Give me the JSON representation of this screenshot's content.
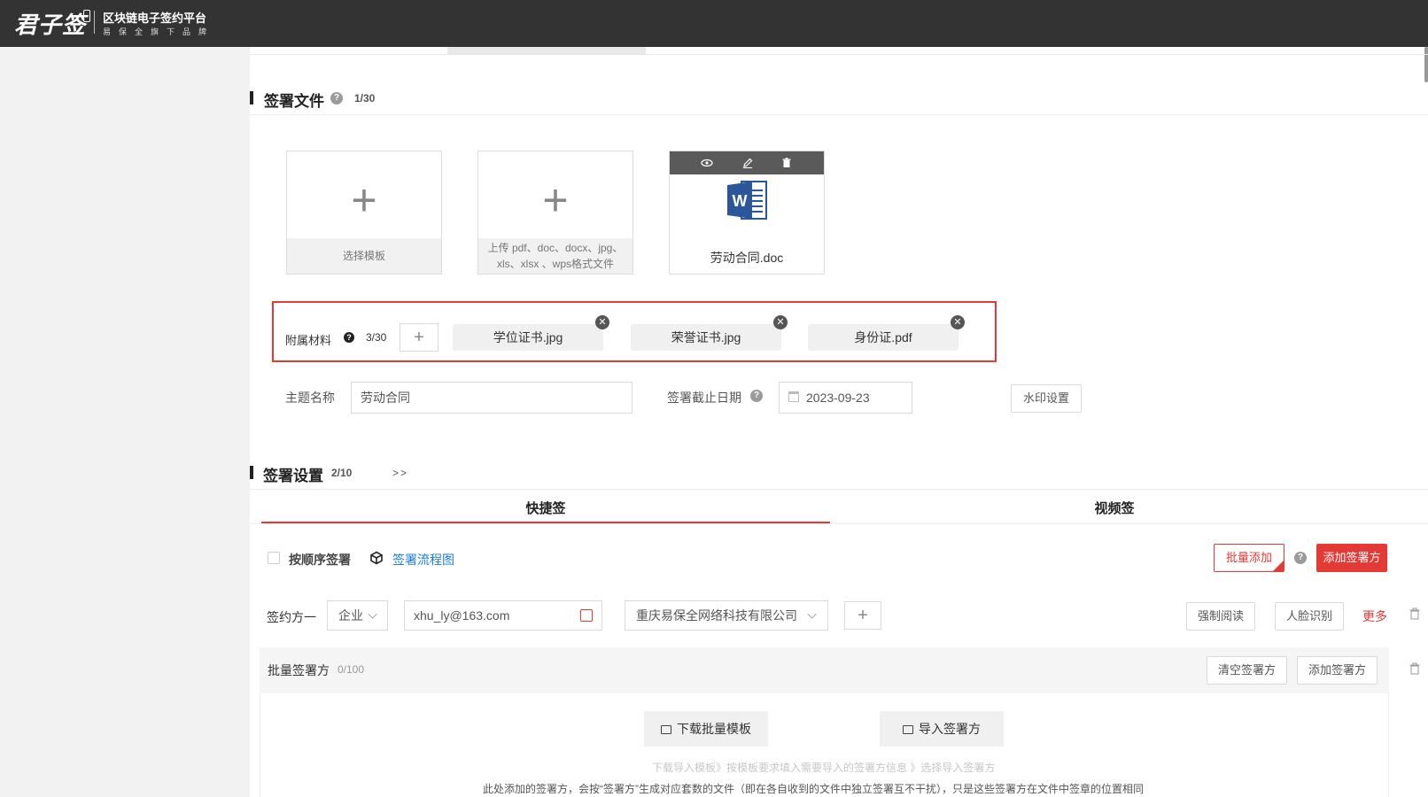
{
  "header": {
    "logo_text": "君子签",
    "platform_title": "区块链电子签约平台",
    "platform_subtitle": "易保全旗下品牌"
  },
  "sign_files": {
    "title": "签署文件",
    "count": "1/30",
    "help_icon": "question-icon",
    "template_card_label": "选择模板",
    "upload_card_hint": "上传 pdf、doc、docx、jpg、xls、xlsx 、wps格式文件",
    "upload_hint_line1": "上传 pdf、doc、docx、jpg、",
    "upload_hint_line2": "xls、xlsx 、wps格式文件",
    "doc_icon": "word-doc-icon",
    "doc_toolbar_icons": [
      "eye-icon",
      "edit-icon",
      "trash-icon"
    ],
    "doc_name": "劳动合同.doc"
  },
  "attachments": {
    "label": "附属材料",
    "count": "3/30",
    "add_label": "+",
    "items": [
      "学位证书.jpg",
      "荣誉证书.jpg",
      "身份证.pdf"
    ],
    "highlight_color": "#e53935"
  },
  "fields": {
    "subject_label": "主题名称",
    "subject_value": "劳动合同",
    "deadline_label": "签署截止日期",
    "deadline_value": "2023-09-23",
    "watermark_button": "水印设置"
  },
  "sign_settings": {
    "title": "签署设置",
    "count": "2/10",
    "expand": ">>",
    "tabs": [
      {
        "label": "快捷签",
        "active": true
      },
      {
        "label": "视频签",
        "active": false
      }
    ],
    "in_order_label": "按顺序签署",
    "flow_chart_link": "签署流程图",
    "batch_add_button": "批量添加",
    "add_signer_button": "添加签署方",
    "accent_color": "#e53935"
  },
  "signer": {
    "label": "签约方一",
    "type_value": "企业",
    "email_value": "xhu_ly@163.com",
    "company_value": "重庆易保全网络科技有限公司",
    "add_label": "+",
    "force_read_button": "强制阅读",
    "face_recog_button": "人脸识别",
    "more_link": "更多"
  },
  "batch": {
    "title": "批量签署方",
    "count": "0/100",
    "clear_button": "清空签署方",
    "add_button": "添加签署方",
    "download_template_button": "下载批量模板",
    "import_button": "导入签署方",
    "steps_hint": "下载导入模板》按模板要求填入需要导入的签署方信息 》选择导入签署方",
    "note": "此处添加的签署方，会按“签署方”生成对应套数的文件（即在各自收到的文件中独立签署互不干扰），只是这些签署方在文件中签章的位置相同"
  }
}
